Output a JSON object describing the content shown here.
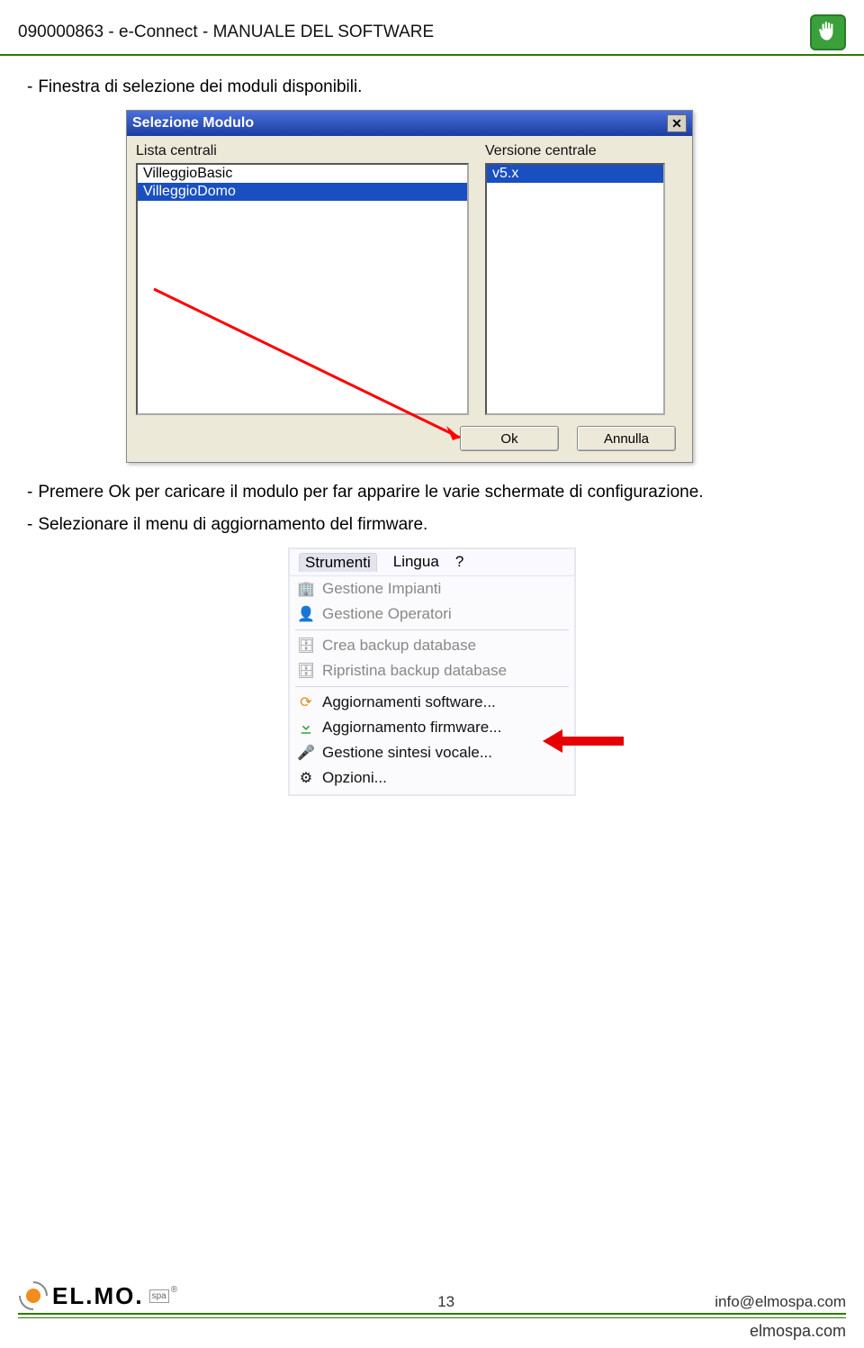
{
  "header": {
    "doc_id": "090000863",
    "product": "e-Connect",
    "title": "MANUALE DEL SOFTWARE"
  },
  "body": {
    "bullet1": "Finestra di selezione dei moduli disponibili.",
    "bullet2": "Premere Ok per caricare il modulo per far apparire le varie schermate di configurazione.",
    "bullet3": "Selezionare il menu di aggiornamento del firmware."
  },
  "dialog": {
    "title": "Selezione Modulo",
    "left_label": "Lista centrali",
    "right_label": "Versione centrale",
    "left_items": [
      "VilleggioBasic",
      "VilleggioDomo"
    ],
    "left_selected_index": 1,
    "right_items": [
      "v5.x"
    ],
    "right_selected_index": 0,
    "ok_label": "Ok",
    "cancel_label": "Annulla"
  },
  "menu": {
    "tabs": [
      "Strumenti",
      "Lingua",
      "?"
    ],
    "active_tab": 0,
    "items": [
      {
        "icon": "building-icon",
        "label": "Gestione Impianti",
        "enabled": false
      },
      {
        "icon": "user-icon",
        "label": "Gestione Operatori",
        "enabled": false
      },
      {
        "sep": true
      },
      {
        "icon": "db-icon",
        "label": "Crea backup database",
        "enabled": false
      },
      {
        "icon": "db-restore-icon",
        "label": "Ripristina backup database",
        "enabled": false
      },
      {
        "sep": true
      },
      {
        "icon": "update-sw-icon",
        "label": "Aggiornamenti software...",
        "enabled": true
      },
      {
        "icon": "download-icon",
        "label": "Aggiornamento firmware...",
        "enabled": true,
        "highlight": true
      },
      {
        "icon": "mic-icon",
        "label": "Gestione sintesi vocale...",
        "enabled": true
      },
      {
        "icon": "gear-icon",
        "label": "Opzioni...",
        "enabled": true
      }
    ]
  },
  "footer": {
    "logo_text": "EL.MO.",
    "logo_suffix": "spa",
    "page": "13",
    "email": "info@elmospa.com",
    "site": "elmospa.com"
  }
}
